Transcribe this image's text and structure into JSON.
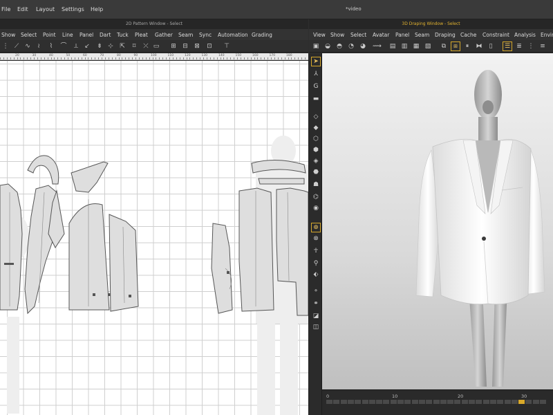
{
  "app": {
    "menu": [
      "File",
      "Edit",
      "Layout",
      "Settings",
      "Help"
    ],
    "document_title": "*video"
  },
  "pattern_window": {
    "title": "2D Pattern Window - Select",
    "menu": [
      "Show",
      "Select",
      "Point",
      "Line",
      "Panel",
      "Dart",
      "Tuck",
      "Pleat",
      "Gather",
      "Seam",
      "Sync",
      "Automation",
      "Grading"
    ],
    "ruler_ticks": [
      "20",
      "30",
      "40",
      "50",
      "60",
      "70",
      "80",
      "90",
      "100",
      "110",
      "120",
      "130",
      "140",
      "150",
      "160",
      "170",
      "180"
    ]
  },
  "draping_window": {
    "title": "3D Draping Window - Select",
    "menu": [
      "View",
      "Show",
      "Select",
      "Avatar",
      "Panel",
      "Seam",
      "Draping",
      "Cache",
      "Constraint",
      "Analysis",
      "Enviro"
    ]
  },
  "timeline": {
    "labels": [
      "0",
      "10",
      "20",
      "30"
    ],
    "current_frame": 27
  },
  "colors": {
    "accent": "#d6a82a",
    "panel_fill": "#dedede",
    "grid": "#cfcfcf"
  }
}
